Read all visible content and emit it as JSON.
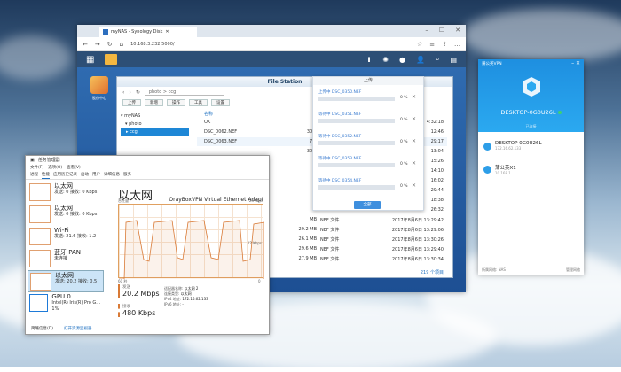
{
  "browser": {
    "tab_title": "myNAS - Synology Disk",
    "address": "10.168.3.232:5000/"
  },
  "desktop": {
    "icon_label": "股份中心"
  },
  "file_station": {
    "title": "File Station",
    "path": "photo > ccg",
    "toolbar": [
      "上传",
      "新增",
      "操作",
      "工具",
      "设置"
    ],
    "tree": {
      "root": "myNAS",
      "folder": "photo",
      "selected": "ccg"
    },
    "column_header": "名称",
    "rows": [
      {
        "name": "OK",
        "size": "",
        "type": "",
        "date": "4:32:18"
      },
      {
        "name": "DSC_0062.NEF",
        "size": "30.2",
        "type": "",
        "date": "12:46"
      },
      {
        "name": "DSC_0063.NEF",
        "size": "7.5",
        "type": "",
        "date": "29:17"
      },
      {
        "name": "",
        "size": "30.7",
        "type": "",
        "date": "13:04"
      },
      {
        "name": "",
        "size": "",
        "type": "",
        "date": "15:26"
      },
      {
        "name": "",
        "size": "",
        "type": "",
        "date": "14:10"
      },
      {
        "name": "",
        "size": "",
        "type": "",
        "date": "16:02"
      },
      {
        "name": "",
        "size": "",
        "type": "",
        "date": "29:44"
      },
      {
        "name": "",
        "size": "",
        "type": "",
        "date": "18:38"
      },
      {
        "name": "",
        "size": "",
        "type": "",
        "date": "26:32"
      },
      {
        "name": "",
        "size": "MB",
        "type": "NEF 文件",
        "date": "2017年8月6日 13:29:42"
      },
      {
        "name": "",
        "size": "29.2 MB",
        "type": "NEF 文件",
        "date": "2017年8月6日 13:29:06"
      },
      {
        "name": "",
        "size": "26.1 MB",
        "type": "NEF 文件",
        "date": "2017年8月6日 13:30:26"
      },
      {
        "name": "",
        "size": "29.6 MB",
        "type": "NEF 文件",
        "date": "2017年8月6日 13:29:40"
      },
      {
        "name": "",
        "size": "27.9 MB",
        "type": "NEF 文件",
        "date": "2017年8月6日 13:30:34"
      }
    ],
    "footer": "219 个项目"
  },
  "upload": {
    "title": "上传",
    "items": [
      {
        "label": "上传中 DSC_0350.NEF",
        "pct": "0 %",
        "fill": 0.0
      },
      {
        "label": "等待中 DSC_0351.NEF",
        "pct": "0 %",
        "fill": 0.0
      },
      {
        "label": "等待中 DSC_0352.NEF",
        "pct": "0 %",
        "fill": 0.0
      },
      {
        "label": "等待中 DSC_0353.NEF",
        "pct": "0 %",
        "fill": 0.0
      },
      {
        "label": "等待中 DSC_0354.NEF",
        "pct": "0 %",
        "fill": 0.0
      }
    ],
    "button": "全部"
  },
  "task_manager": {
    "title": "任务管理器",
    "menu": [
      "文件(F)",
      "选项(O)",
      "查看(V)"
    ],
    "tabs": [
      "进程",
      "性能",
      "应用历史记录",
      "启动",
      "用户",
      "详细信息",
      "服务"
    ],
    "side": [
      {
        "name": "以太网",
        "sub": "发送: 0 接收: 0 Kbps"
      },
      {
        "name": "以太网",
        "sub": "发送: 0 接收: 0 Kbps"
      },
      {
        "name": "Wi-Fi",
        "sub": "发送: 21.6 接收: 1.2"
      },
      {
        "name": "蓝牙 PAN",
        "sub": "未连接"
      },
      {
        "name": "以太网",
        "sub": "发送: 20.2 接收: 0.5"
      },
      {
        "name": "GPU 0",
        "sub": "Intel(R) Iris(R) Pro G... 1%"
      }
    ],
    "main_title": "以太网",
    "adapter": "OrayBoxVPN Virtual Ethernet Adapt",
    "throughput_label": "吞吐量",
    "axis_top": "24 Kbps",
    "axis_mid": "12 Kbps",
    "axis_bottom_left": "60 秒",
    "axis_bottom_right": "0",
    "send_label": "发送",
    "send_value": "20.2 Mbps",
    "recv_label": "接收",
    "recv_value": "480 Kbps",
    "adapter_name_label": "适配器名称:",
    "adapter_name_value": "以太网 2",
    "conn_type_label": "连接类型:",
    "conn_type_value": "以太网",
    "ipv4_label": "IPv4 地址:",
    "ipv4_value": "172.16.62.133",
    "ipv6_label": "IPv6 地址:",
    "ipv6_value": "-",
    "footer_brief": "简略信息(D)",
    "footer_link": "打开资源监视器"
  },
  "vpn": {
    "title": "蒲公英VPN",
    "device": "DESKTOP-0G0U26L",
    "status_hint": "已连接",
    "devices": [
      {
        "name": "DESKTOP-0G0U26L",
        "ip": "172.16.62.133"
      },
      {
        "name": "蒲公英X1",
        "ip": "10.168.1"
      }
    ],
    "footer_left": "所属网络: NAS",
    "footer_right": "管理网络"
  }
}
